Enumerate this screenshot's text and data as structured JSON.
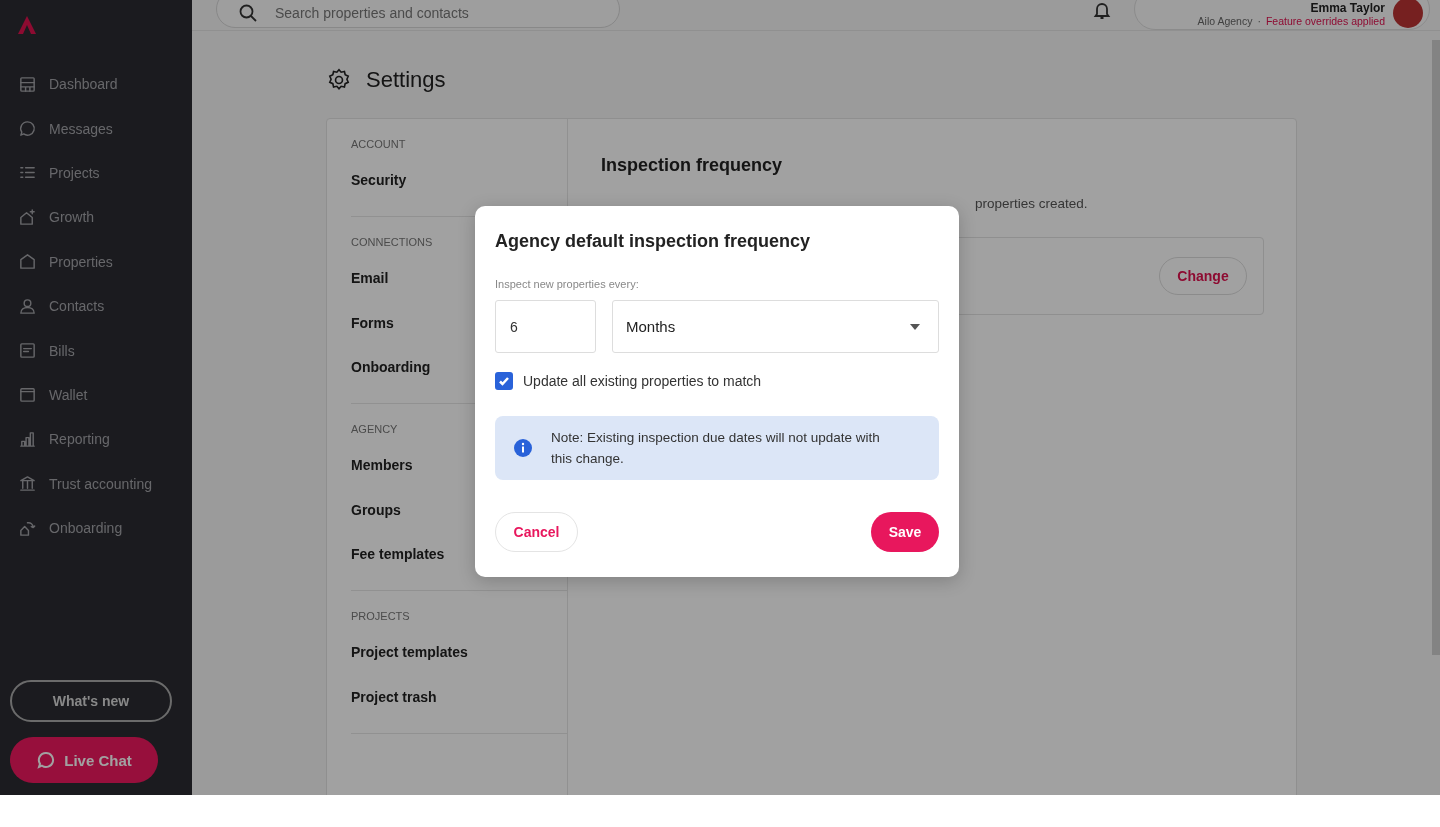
{
  "topbar": {
    "search": {
      "placeholder": "Search properties and contacts"
    },
    "user": {
      "name": "Emma Taylor",
      "agency": "Ailo Agency",
      "separator": "·",
      "note": "Feature overrides applied"
    }
  },
  "sidebar": {
    "items": [
      {
        "label": "Dashboard"
      },
      {
        "label": "Messages"
      },
      {
        "label": "Projects"
      },
      {
        "label": "Growth"
      },
      {
        "label": "Properties"
      },
      {
        "label": "Contacts"
      },
      {
        "label": "Bills"
      },
      {
        "label": "Wallet"
      },
      {
        "label": "Reporting"
      },
      {
        "label": "Trust accounting"
      },
      {
        "label": "Onboarding"
      }
    ],
    "whats_new": "What's new",
    "live_chat": "Live Chat"
  },
  "page": {
    "title": "Settings"
  },
  "settings_nav": {
    "sections": [
      {
        "heading": "ACCOUNT",
        "items": [
          "Security"
        ]
      },
      {
        "heading": "CONNECTIONS",
        "items": [
          "Email",
          "Forms",
          "Onboarding"
        ]
      },
      {
        "heading": "AGENCY",
        "items": [
          "Members",
          "Groups",
          "Fee templates"
        ]
      },
      {
        "heading": "PROJECTS",
        "items": [
          "Project templates",
          "Project trash"
        ]
      }
    ]
  },
  "content": {
    "title": "Inspection frequency",
    "description": "properties created.",
    "change_button": "Change"
  },
  "dialog": {
    "title": "Agency default inspection frequency",
    "field_label": "Inspect new properties every:",
    "number": "6",
    "unit": "Months",
    "checkbox": {
      "label": "Update all existing properties to match",
      "checked": true
    },
    "note": "Note: Existing inspection due dates will not update with this change.",
    "cancel": "Cancel",
    "save": "Save"
  }
}
